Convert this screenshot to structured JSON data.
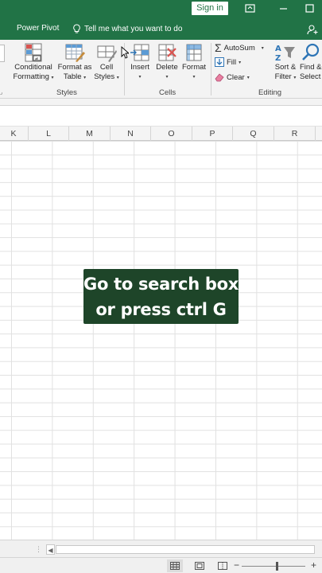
{
  "titlebar": {
    "signin_label": "Sign in"
  },
  "tabs": {
    "power_pivot": "Power Pivot",
    "tell_me": "Tell me what you want to do"
  },
  "ribbon": {
    "styles": {
      "conditional_line1": "Conditional",
      "conditional_line2": "Formatting",
      "format_table_line1": "Format as",
      "format_table_line2": "Table",
      "cell_styles_line1": "Cell",
      "cell_styles_line2": "Styles",
      "group_label": "Styles"
    },
    "cells": {
      "insert": "Insert",
      "delete": "Delete",
      "format": "Format",
      "group_label": "Cells"
    },
    "editing": {
      "autosum": "AutoSum",
      "fill": "Fill",
      "clear": "Clear",
      "sort_line1": "Sort &",
      "sort_line2": "Filter",
      "find_line1": "Find &",
      "find_line2": "Select",
      "group_label": "Editing"
    }
  },
  "columns": [
    "K",
    "L",
    "M",
    "N",
    "O",
    "P",
    "Q",
    "R"
  ],
  "caption": {
    "line1": "Go to search box",
    "line2": "or press ctrl G"
  },
  "colors": {
    "excel_green": "#217346",
    "caption_bg": "#1e4529"
  }
}
